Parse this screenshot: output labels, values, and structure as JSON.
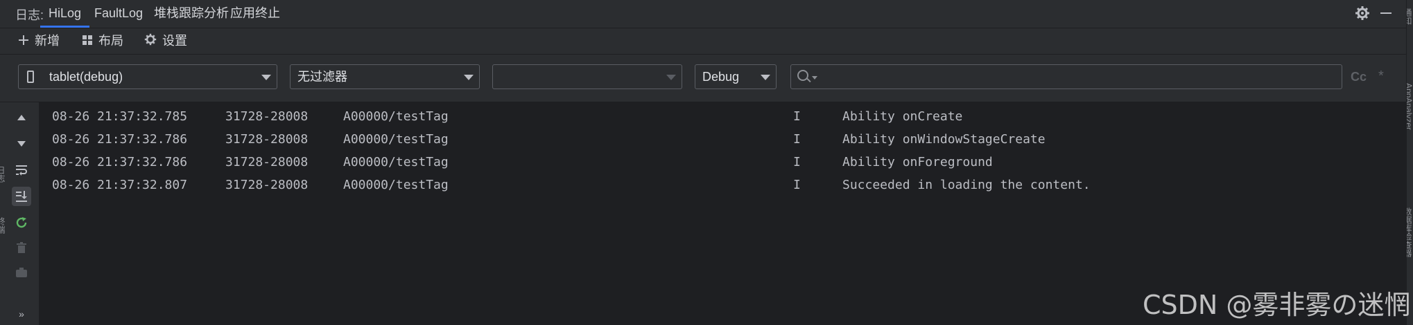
{
  "header": {
    "label": "日志:",
    "tabs": [
      {
        "label": "HiLog",
        "active": true
      },
      {
        "label": "FaultLog",
        "active": false
      },
      {
        "label": "堆栈跟踪分析",
        "active": false
      },
      {
        "label": "应用终止",
        "active": false
      }
    ]
  },
  "toolbar": {
    "new_label": "新增",
    "layout_label": "布局",
    "settings_label": "设置"
  },
  "filters": {
    "device": "tablet(debug)",
    "filter": "无过滤器",
    "process": "",
    "level": "Debug",
    "search_placeholder": "",
    "case_label": "Cc",
    "regex_label": "*"
  },
  "left_rail": {
    "labels": [
      "日志",
      "终端"
    ]
  },
  "log": {
    "rows": [
      {
        "time": "08-26 21:37:32.785",
        "pid": "31728-28008",
        "tag": "A00000/testTag",
        "level": "I",
        "message": "Ability onCreate"
      },
      {
        "time": "08-26 21:37:32.786",
        "pid": "31728-28008",
        "tag": "A00000/testTag",
        "level": "I",
        "message": "Ability onWindowStageCreate"
      },
      {
        "time": "08-26 21:37:32.786",
        "pid": "31728-28008",
        "tag": "A00000/testTag",
        "level": "I",
        "message": "Ability onForeground"
      },
      {
        "time": "08-26 21:37:32.807",
        "pid": "31728-28008",
        "tag": "A00000/testTag",
        "level": "I",
        "message": "Succeeded in loading the content."
      }
    ]
  },
  "right_rail": {
    "labels": [
      "通知",
      "AppAnalyzer",
      "数据库检查器"
    ]
  },
  "watermark": "CSDN @雾非雾の迷惘",
  "colors": {
    "background": "#2b2d30",
    "log_background": "#1e1f22",
    "accent": "#3574f0"
  }
}
